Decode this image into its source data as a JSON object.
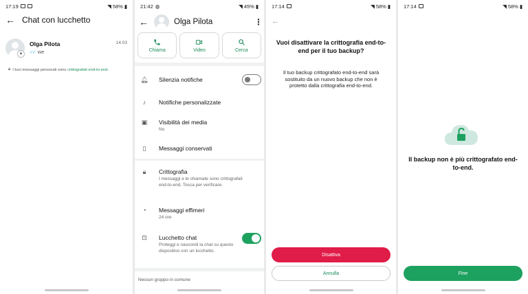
{
  "panel1": {
    "status": {
      "time": "17:19",
      "battery": "58%"
    },
    "title": "Chat con lucchetto",
    "chat": {
      "name": "Olga Pilota",
      "time": "14:03",
      "last_message": "we"
    },
    "note_prefix": "I tuoi messaggi personali sono ",
    "note_link": "crittografati end-to-end",
    "note_suffix": "."
  },
  "panel2": {
    "status": {
      "time": "21:42",
      "battery": "45%"
    },
    "contact_name": "Olga Pilota",
    "actions": [
      {
        "label": "Chiama",
        "icon": "phone-icon"
      },
      {
        "label": "Video",
        "icon": "video-icon"
      },
      {
        "label": "Cerca",
        "icon": "search-icon"
      }
    ],
    "settings": {
      "mute": {
        "title": "Silenzia notifiche",
        "icon": "bell-icon",
        "enabled": false
      },
      "custom_notifications": {
        "title": "Notifiche personalizzate",
        "icon": "music-note-icon"
      },
      "media_visibility": {
        "title": "Visibilità dei media",
        "subtitle": "No",
        "icon": "image-icon"
      },
      "kept_messages": {
        "title": "Messaggi conservati",
        "icon": "bookmark-icon"
      },
      "encryption": {
        "title": "Crittografia",
        "subtitle": "I messaggi e le chiamate sono crittografati end-to-end. Tocca per verificare.",
        "icon": "lock-icon"
      },
      "disappearing": {
        "title": "Messaggi effimeri",
        "subtitle": "24 ore",
        "icon": "timer-icon"
      },
      "chat_lock": {
        "title": "Lucchetto chat",
        "subtitle": "Proteggi e nascondi la chat su questo dispositivo con un lucchetto.",
        "icon": "chat-lock-icon",
        "enabled": true
      }
    },
    "groups_label": "Nessun gruppo in comune"
  },
  "panel3": {
    "status": {
      "time": "17:14",
      "battery": "58%"
    },
    "title": "Vuoi disattivare la crittografia end-to-end per il tuo backup?",
    "body": "Il tuo backup crittografato end-to-end sarà sostituito da un nuovo backup che non è protetto dalla crittografia end-to-end.",
    "primary_button": "Disattiva",
    "secondary_button": "Annulla"
  },
  "panel4": {
    "status": {
      "time": "17:14",
      "battery": "58%"
    },
    "message": "Il backup non è più crittografato end-to-end.",
    "button": "Fine"
  },
  "colors": {
    "accent_green": "#1da15f",
    "danger_red": "#e01c48",
    "link_green": "#1b8a59"
  }
}
